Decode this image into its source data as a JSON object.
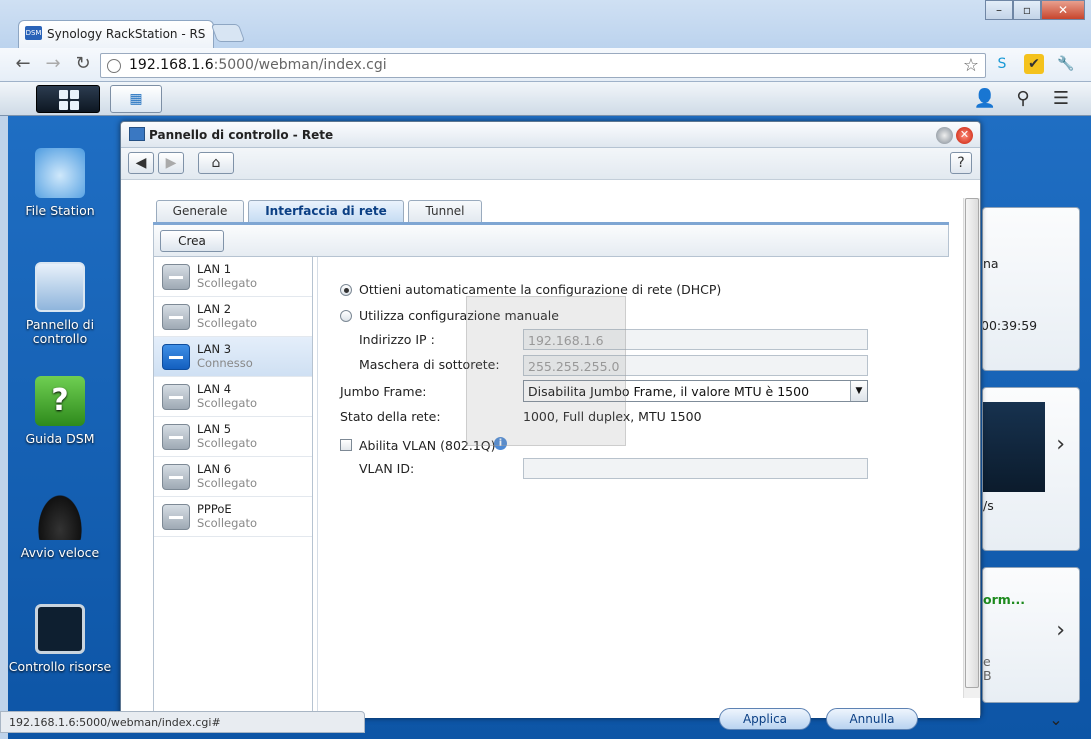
{
  "browser": {
    "tab_title": "Synology RackStation - RS",
    "tab_favicon": "DSM",
    "url_host": "192.168.1.6",
    "url_rest": ":5000/webman/index.cgi",
    "status_url": "192.168.1.6:5000/webman/index.cgi#"
  },
  "desktop": {
    "icons": [
      {
        "label": "File Station"
      },
      {
        "label": "Pannello di controllo"
      },
      {
        "label": "Guida DSM"
      },
      {
        "label": "Avvio veloce"
      },
      {
        "label": "Controllo risorse"
      }
    ],
    "widgets": {
      "w1_text1": "na",
      "w1_text2": "00:39:59",
      "w2_text": "/s",
      "w3_title": "orm...",
      "w3_text1": "e",
      "w3_text2": "B"
    }
  },
  "window": {
    "title": "Pannello di controllo - Rete",
    "tabs": [
      {
        "label": "Generale"
      },
      {
        "label": "Interfaccia di rete",
        "active": true
      },
      {
        "label": "Tunnel"
      }
    ],
    "create_label": "Crea",
    "interfaces": [
      {
        "name": "LAN 1",
        "status": "Scollegato"
      },
      {
        "name": "LAN 2",
        "status": "Scollegato"
      },
      {
        "name": "LAN 3",
        "status": "Connesso",
        "selected": true
      },
      {
        "name": "LAN 4",
        "status": "Scollegato"
      },
      {
        "name": "LAN 5",
        "status": "Scollegato"
      },
      {
        "name": "LAN 6",
        "status": "Scollegato"
      },
      {
        "name": "PPPoE",
        "status": "Scollegato"
      }
    ],
    "detail": {
      "dhcp_label": "Ottieni automaticamente la configurazione di rete (DHCP)",
      "manual_label": "Utilizza configurazione manuale",
      "ip_label": "Indirizzo IP :",
      "ip_value": "192.168.1.6",
      "mask_label": "Maschera di sottorete:",
      "mask_value": "255.255.255.0",
      "jumbo_label": "Jumbo Frame:",
      "jumbo_value": "Disabilita Jumbo Frame, il valore MTU è 1500",
      "status_label": "Stato della rete:",
      "status_value": "1000, Full duplex, MTU 1500",
      "vlan_label": "Abilita VLAN (802.1Q)",
      "vlan_id_label": "VLAN ID:",
      "vlan_id_value": ""
    },
    "apply_label": "Applica",
    "cancel_label": "Annulla"
  }
}
